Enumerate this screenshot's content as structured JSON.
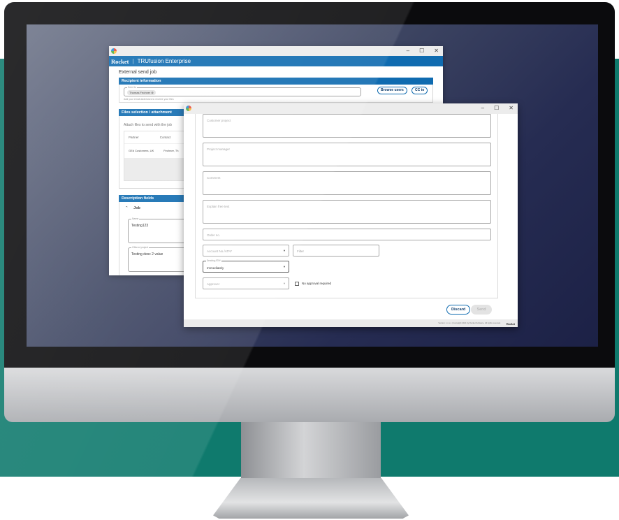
{
  "window1": {
    "controls": [
      "–",
      "☐",
      "✕"
    ],
    "brand": "Rocket",
    "product": "TRUfusion Enterprise",
    "page_title": "External send job",
    "recipient_section": "Recipient information",
    "to_label": "Send to",
    "recipient_chip": "Thomas Fechner ⊗",
    "to_hint": "Add your email addresses to receive your files",
    "browse_users": "Browse users",
    "cc_to": "CC to",
    "files_section": "Files selection / attachment",
    "files_hint": "Attach files to send with the job",
    "files_columns": [
      "Partner",
      "Contact"
    ],
    "files_row": [
      "GEd Customers, UK",
      "Fechner, Th"
    ],
    "description_section": "Description fields",
    "job_group": "Job",
    "job_field_label": "Name",
    "job_field_value": "Testing123",
    "desc_field_label": "Offered project",
    "desc_field_value": "Testing desc 2 value"
  },
  "window2": {
    "controls": [
      "–",
      "☐",
      "✕"
    ],
    "fields": [
      "Customer project",
      "Project manager",
      "Comment",
      "Explain free text"
    ],
    "order_no": "Order no.",
    "account": "Account No./ATN*",
    "filter": "Filter",
    "sending_label": "Sending ATN*",
    "sending_value": "Immediately",
    "approver": "Approver",
    "no_approval": "No approval required",
    "discard": "Discard",
    "send": "Send",
    "footer": "Version: x.x.x.x | Copyright 2021 by Rocket Software. All rights reserved.",
    "footer_brand": "Rocket"
  }
}
